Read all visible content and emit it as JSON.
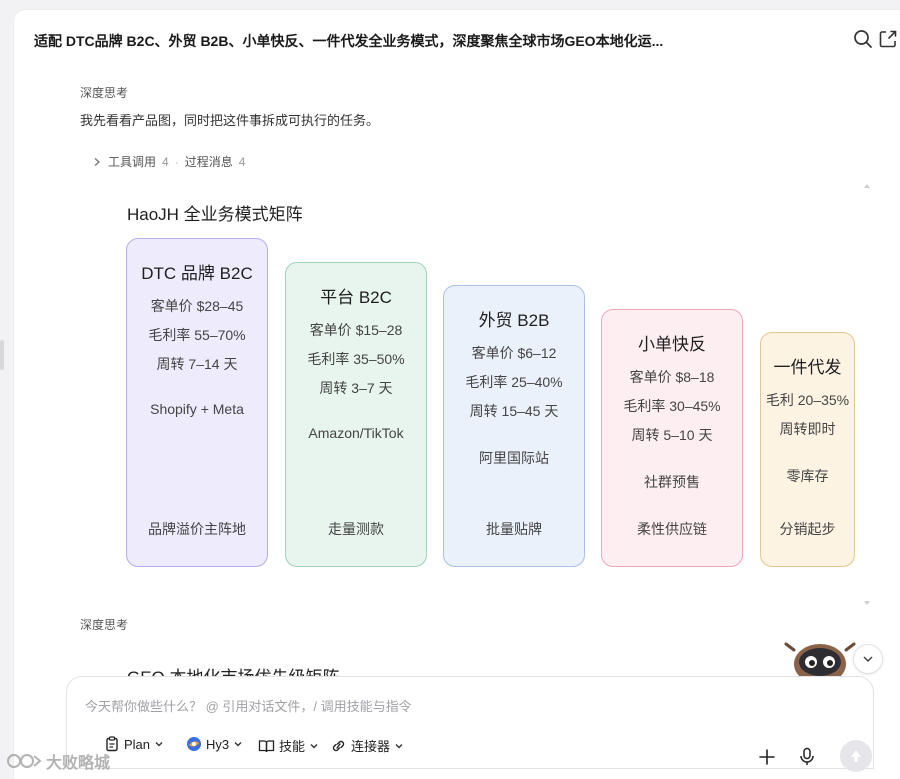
{
  "header": {
    "title": "适配 DTC品牌 B2C、外贸 B2B、小单快反、一件代发全业务模式，深度聚焦全球市场GEO本地化运..."
  },
  "chat": {
    "thinking_label_1": "深度思考",
    "message_1": "我先看看产品图，同时把这件事拆成可执行的任务。",
    "tools": {
      "tool_calls_label": "工具调用",
      "tool_calls_count": "4",
      "process_label": "过程消息",
      "process_count": "4"
    },
    "thinking_label_2": "深度思考"
  },
  "matrix": {
    "title": "HaoJH 全业务模式矩阵",
    "cards": [
      {
        "title": "DTC 品牌 B2C",
        "price": "客单价 $28–45",
        "margin": "毛利率 55–70%",
        "turnover": "周转 7–14 天",
        "channel": "Shopify + Meta",
        "role": "品牌溢价主阵地",
        "bg": "#eeebfd",
        "border": "#b5abec"
      },
      {
        "title": "平台 B2C",
        "price": "客单价 $15–28",
        "margin": "毛利率 35–50%",
        "turnover": "周转 3–7 天",
        "channel": "Amazon/TikTok",
        "role": "走量测款",
        "bg": "#e8f5ef",
        "border": "#9fd1b6"
      },
      {
        "title": "外贸 B2B",
        "price": "客单价 $6–12",
        "margin": "毛利率 25–40%",
        "turnover": "周转 15–45 天",
        "channel": "阿里国际站",
        "role": "批量贴牌",
        "bg": "#ebf1fb",
        "border": "#a8c0e6"
      },
      {
        "title": "小单快反",
        "price": "客单价 $8–18",
        "margin": "毛利率 30–45%",
        "turnover": "周转 5–10 天",
        "channel": "社群预售",
        "role": "柔性供应链",
        "bg": "#fdeef1",
        "border": "#eba9b7"
      },
      {
        "title": "一件代发",
        "margin": "毛利 20–35%",
        "turnover": "周转即时",
        "channel": "零库存",
        "role": "分销起步",
        "bg": "#fcf3e3",
        "border": "#e3c58f"
      }
    ]
  },
  "geo": {
    "title": "GEO 本地化市场优先级矩阵"
  },
  "composer": {
    "placeholder": "今天帮你做些什么？ @ 引用对话文件，/ 调用技能与指令",
    "plan_label": "Plan",
    "model_label": "Hy3",
    "skills_label": "技能",
    "connector_label": "连接器"
  },
  "watermark": {
    "text": "大败略城"
  },
  "icons": {
    "search": "search-icon",
    "edit": "edit-icon",
    "plus": "plus-icon",
    "mic": "mic-icon",
    "send": "send-icon"
  }
}
